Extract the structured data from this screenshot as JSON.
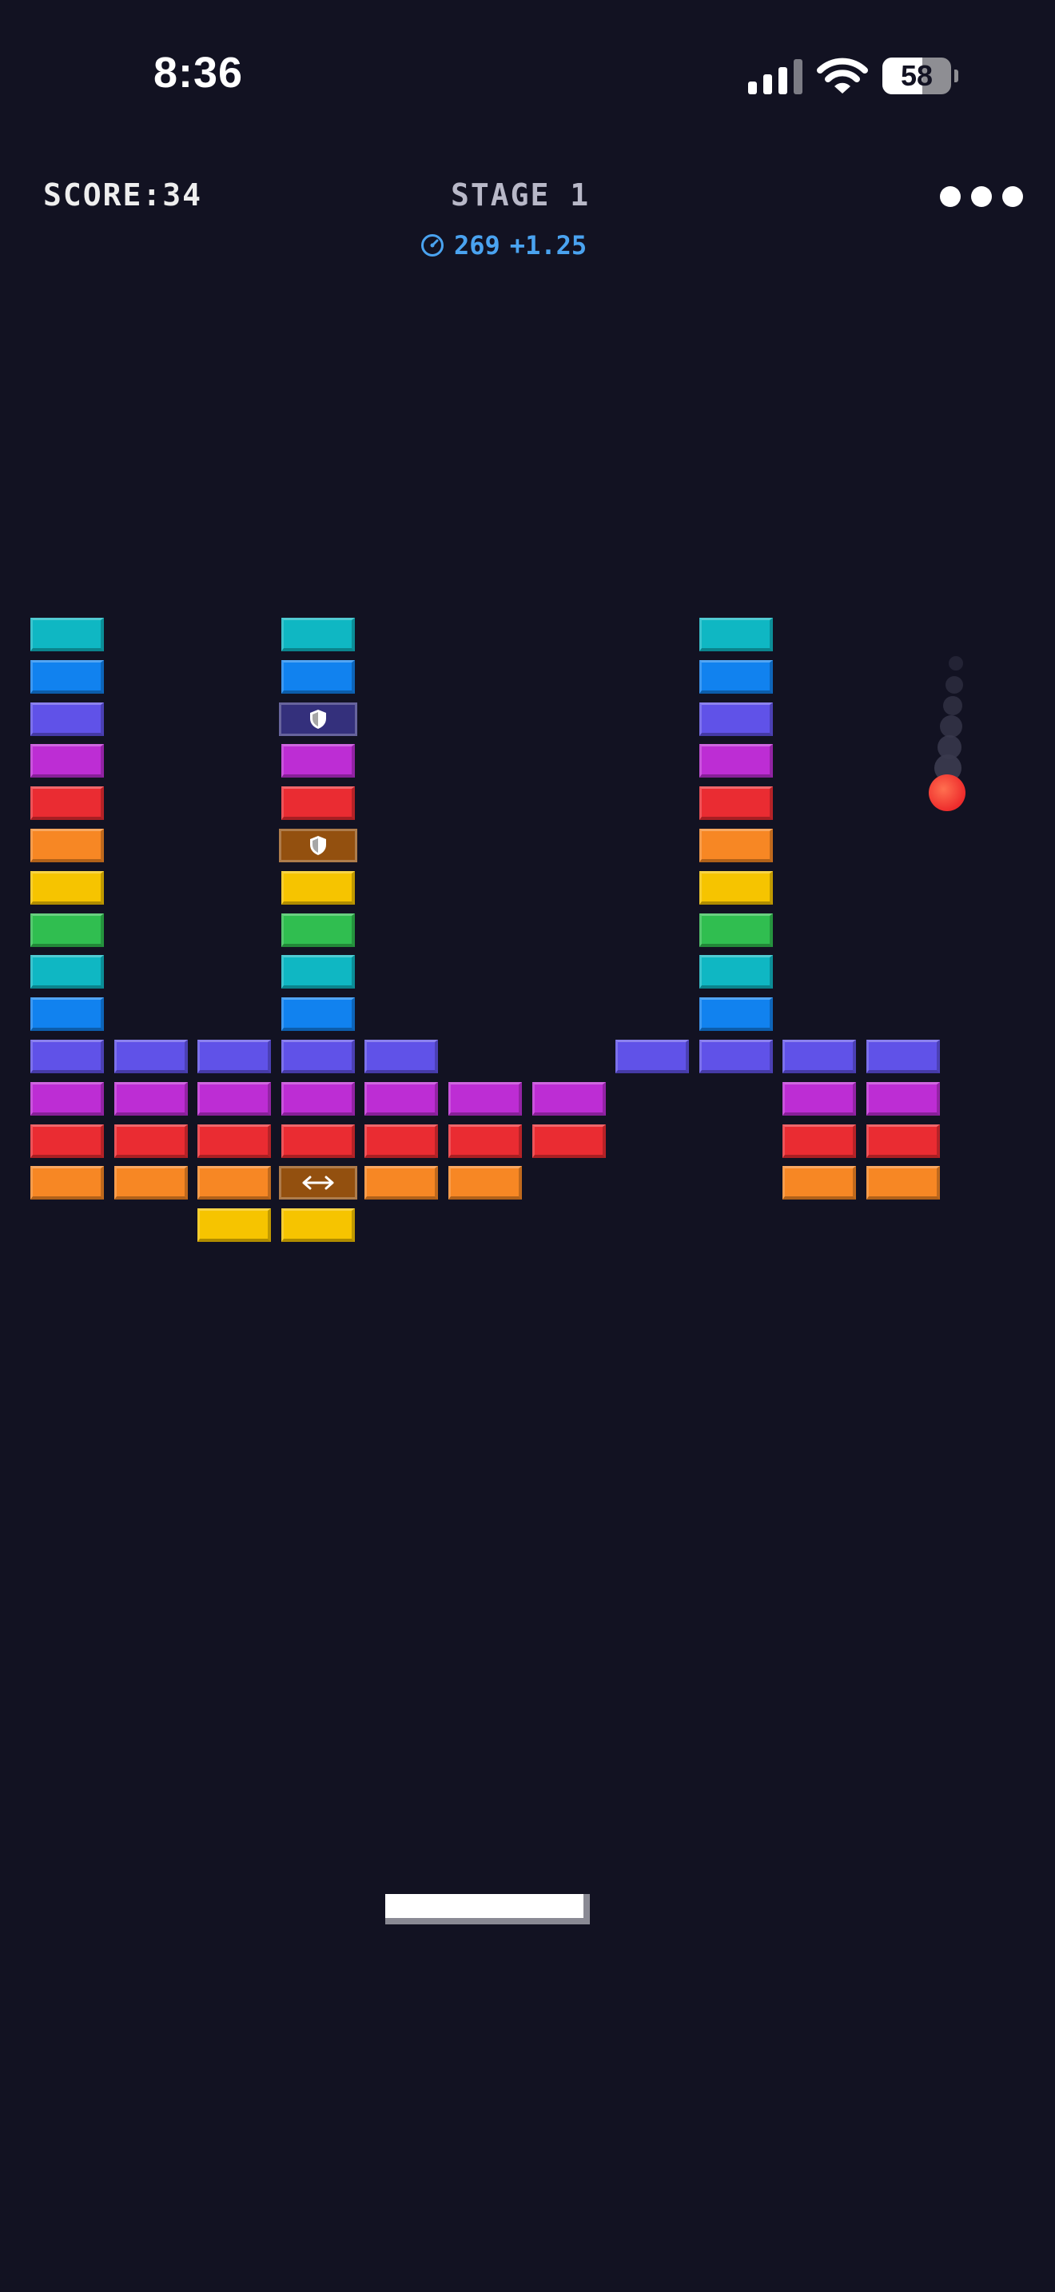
{
  "status_bar": {
    "time": "8:36",
    "battery_level": 58,
    "battery_label": "58",
    "signal_bars": 4,
    "icons": [
      "signal-bars-icon",
      "wifi-icon",
      "battery-icon"
    ]
  },
  "hud": {
    "score_label": "SCORE:34",
    "stage_label": "STAGE 1",
    "speed_value": "269",
    "speed_delta": "+1.25",
    "speed_icon": "speedometer-icon",
    "menu_icon": "more-dots-icon"
  },
  "colors": {
    "background": "#121222",
    "teal": "#0fb7c3",
    "blue": "#1182ef",
    "indigo": "#6052e8",
    "purple": "#bd2dd4",
    "red": "#ea2c32",
    "orange": "#f78724",
    "yellow": "#f6c400",
    "green": "#30be50",
    "shield_dark_indigo": "#34307c",
    "brown": "#93500f",
    "ball": "#ee2c2c",
    "paddle": "#ffffff",
    "speed_text": "#4aa3f0"
  },
  "board": {
    "columns": 11,
    "rows": [
      [
        "teal",
        null,
        null,
        "teal",
        null,
        null,
        null,
        null,
        "teal",
        null,
        null
      ],
      [
        "blue",
        null,
        null,
        "blue",
        null,
        null,
        null,
        null,
        "blue",
        null,
        null
      ],
      [
        "indigo",
        null,
        null,
        "shield-indigo",
        null,
        null,
        null,
        null,
        "indigo",
        null,
        null
      ],
      [
        "purple",
        null,
        null,
        "purple",
        null,
        null,
        null,
        null,
        "purple",
        null,
        null
      ],
      [
        "red",
        null,
        null,
        "red",
        null,
        null,
        null,
        null,
        "red",
        null,
        null
      ],
      [
        "orange",
        null,
        null,
        "shield-brown",
        null,
        null,
        null,
        null,
        "orange",
        null,
        null
      ],
      [
        "yellow",
        null,
        null,
        "yellow",
        null,
        null,
        null,
        null,
        "yellow",
        null,
        null
      ],
      [
        "green",
        null,
        null,
        "green",
        null,
        null,
        null,
        null,
        "green",
        null,
        null
      ],
      [
        "teal",
        null,
        null,
        "teal",
        null,
        null,
        null,
        null,
        "teal",
        null,
        null
      ],
      [
        "blue",
        null,
        null,
        "blue",
        null,
        null,
        null,
        null,
        "blue",
        null,
        null
      ],
      [
        "indigo",
        "indigo",
        "indigo",
        "indigo",
        "indigo",
        null,
        null,
        "indigo",
        "indigo",
        "indigo",
        "indigo"
      ],
      [
        "purple",
        "purple",
        "purple",
        "purple",
        "purple",
        "purple",
        "purple",
        null,
        null,
        "purple",
        "purple"
      ],
      [
        "red",
        "red",
        "red",
        "red",
        "red",
        "red",
        "red",
        null,
        null,
        "red",
        "red"
      ],
      [
        "orange",
        "orange",
        "orange",
        "expand-brown",
        "orange",
        "orange",
        null,
        null,
        null,
        "orange",
        "orange"
      ],
      [
        null,
        null,
        "yellow",
        "yellow",
        null,
        null,
        null,
        null,
        null,
        null,
        null
      ]
    ],
    "special_bricks": {
      "shield-indigo": {
        "base": "shield_dark_indigo",
        "icon": "shield-icon"
      },
      "shield-brown": {
        "base": "brown",
        "icon": "shield-icon"
      },
      "expand-brown": {
        "base": "brown",
        "icon": "expand-arrows-icon"
      }
    }
  },
  "ball": {
    "icon": "ball-icon",
    "trail_icon": "ball-trail"
  },
  "paddle": {
    "icon": "paddle"
  }
}
